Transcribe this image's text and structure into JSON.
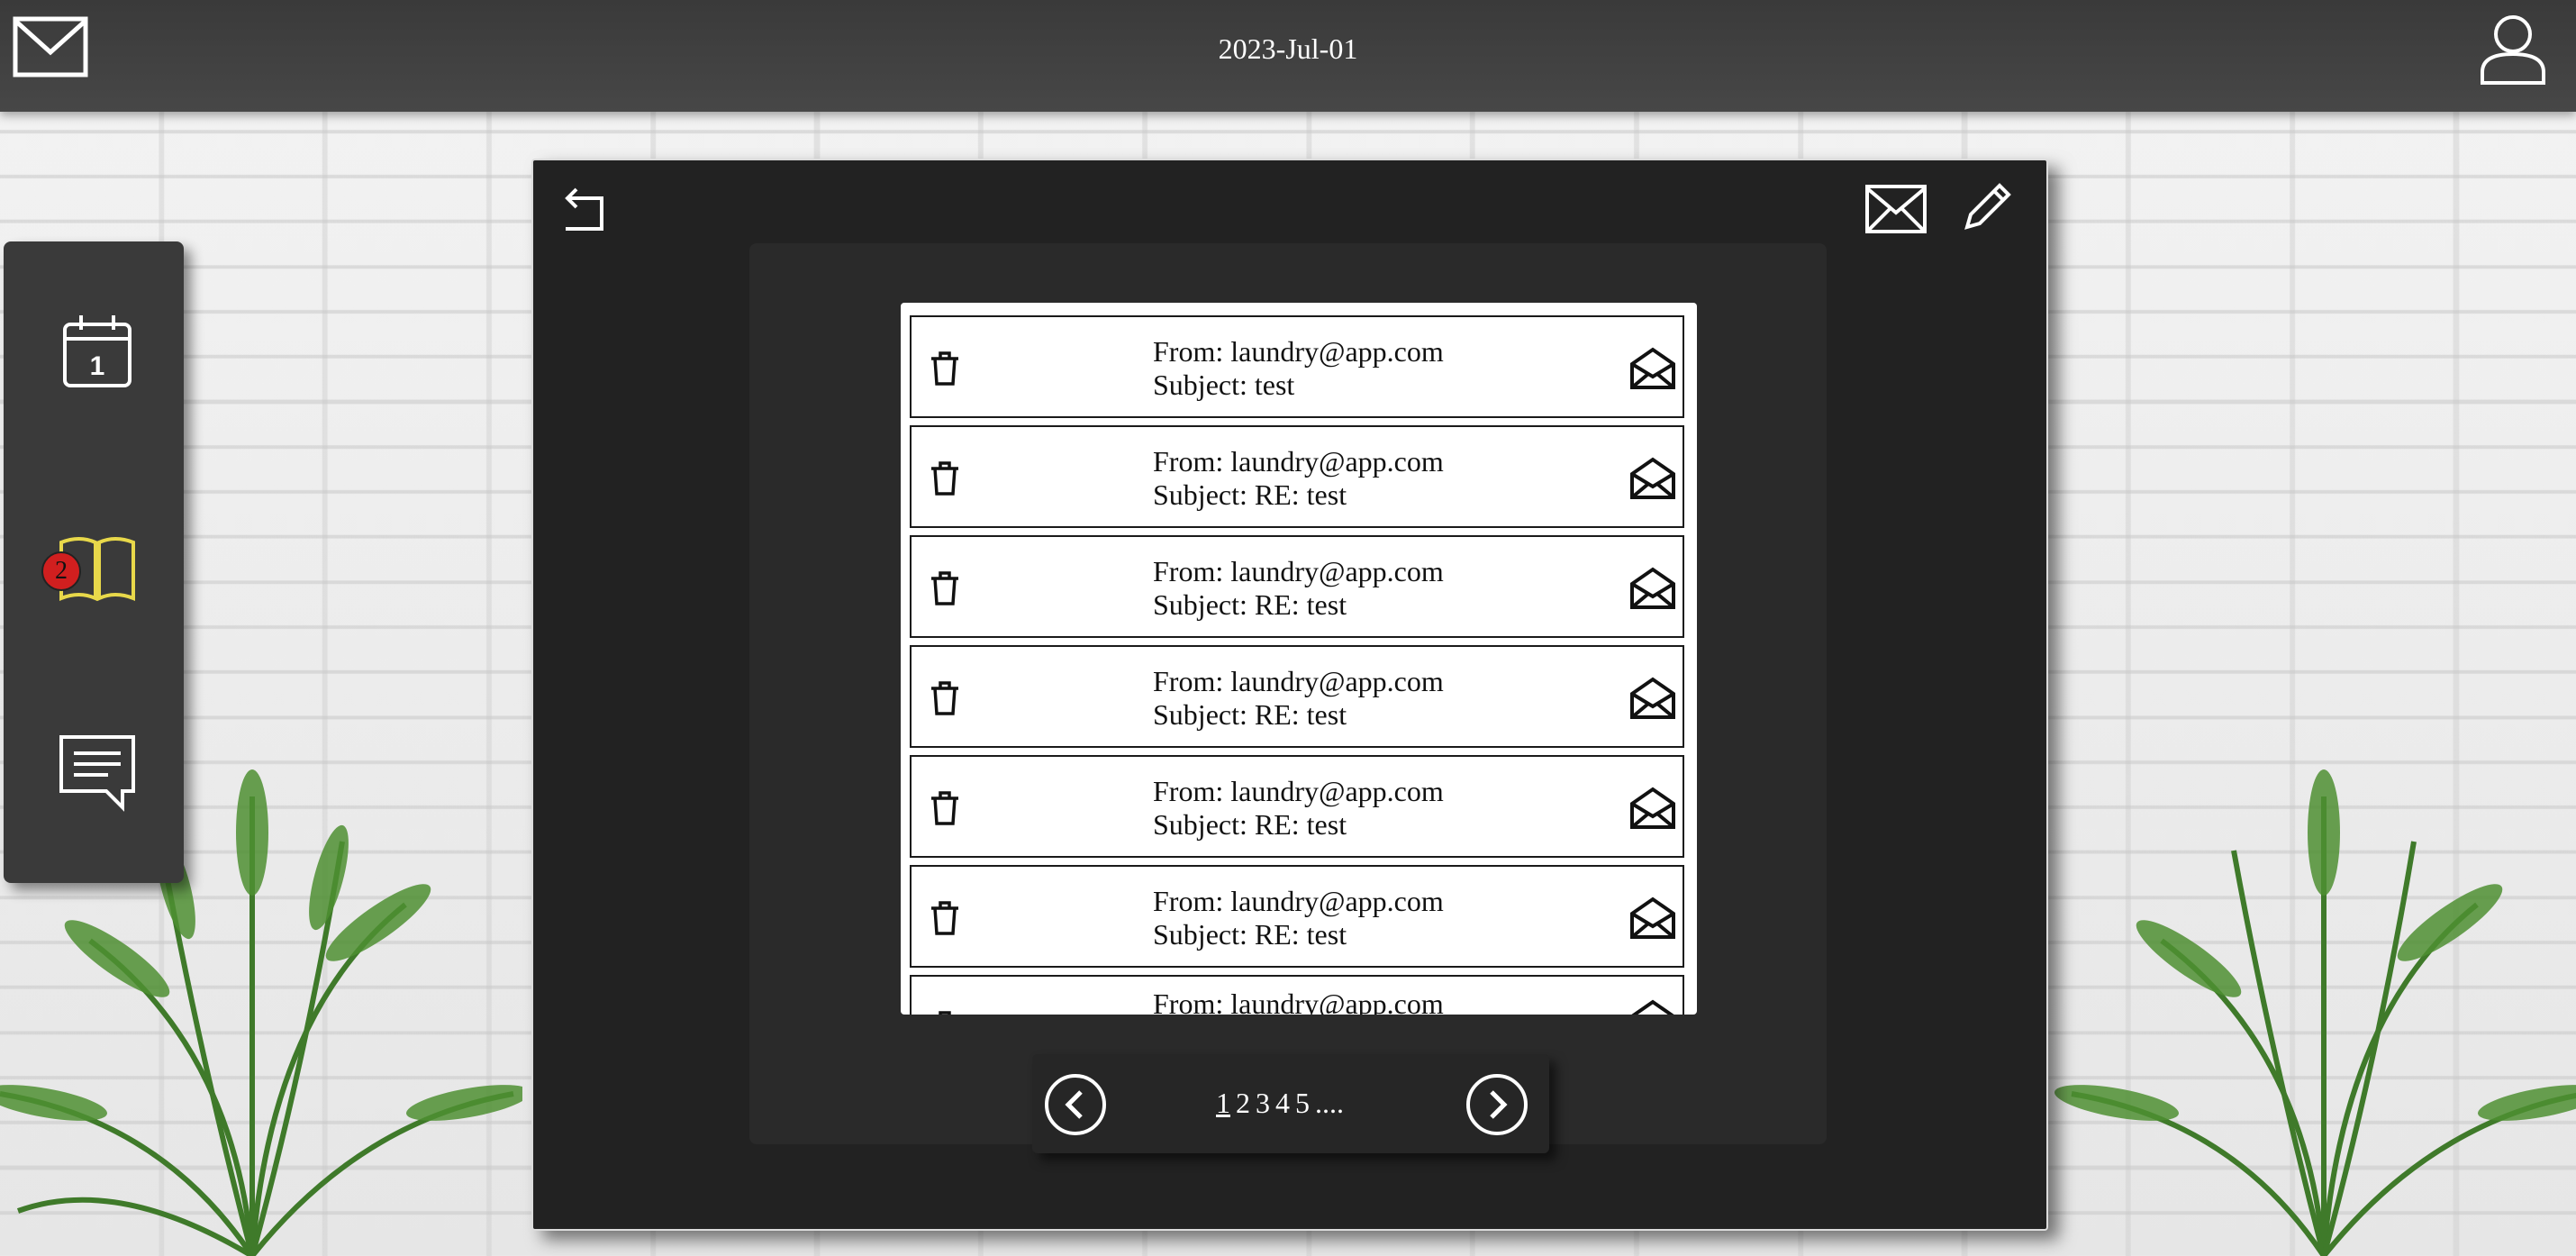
{
  "header": {
    "date": "2023-Jul-01"
  },
  "sidebar": {
    "calendar_day": "1",
    "book_badge": "2"
  },
  "messages": [
    {
      "from": "From: laundry@app.com",
      "subject": "Subject: test"
    },
    {
      "from": "From: laundry@app.com",
      "subject": "Subject: RE: test"
    },
    {
      "from": "From: laundry@app.com",
      "subject": "Subject: RE: test"
    },
    {
      "from": "From: laundry@app.com",
      "subject": "Subject: RE: test"
    },
    {
      "from": "From: laundry@app.com",
      "subject": "Subject: RE: test"
    },
    {
      "from": "From: laundry@app.com",
      "subject": "Subject: RE: test"
    },
    {
      "from": "From: laundry@app.com",
      "subject": ""
    }
  ],
  "pagination": {
    "pages": [
      "1",
      "2",
      "3",
      "4",
      "5"
    ],
    "current": "1",
    "ellipsis": "...."
  },
  "icons": {
    "top_left": "mail-icon",
    "top_right": "user-icon",
    "sidebar": [
      "calendar-icon",
      "book-icon",
      "chat-icon"
    ],
    "modal": [
      "back-arrow-icon",
      "envelope-icon",
      "pencil-icon"
    ],
    "row": [
      "trash-icon",
      "open-envelope-icon"
    ],
    "pager": [
      "chevron-left-icon",
      "chevron-right-icon"
    ]
  },
  "colors": {
    "topbar": "#474747",
    "modal": "#222222",
    "badge": "#d11f1f",
    "book_icon": "#e8d84a"
  }
}
